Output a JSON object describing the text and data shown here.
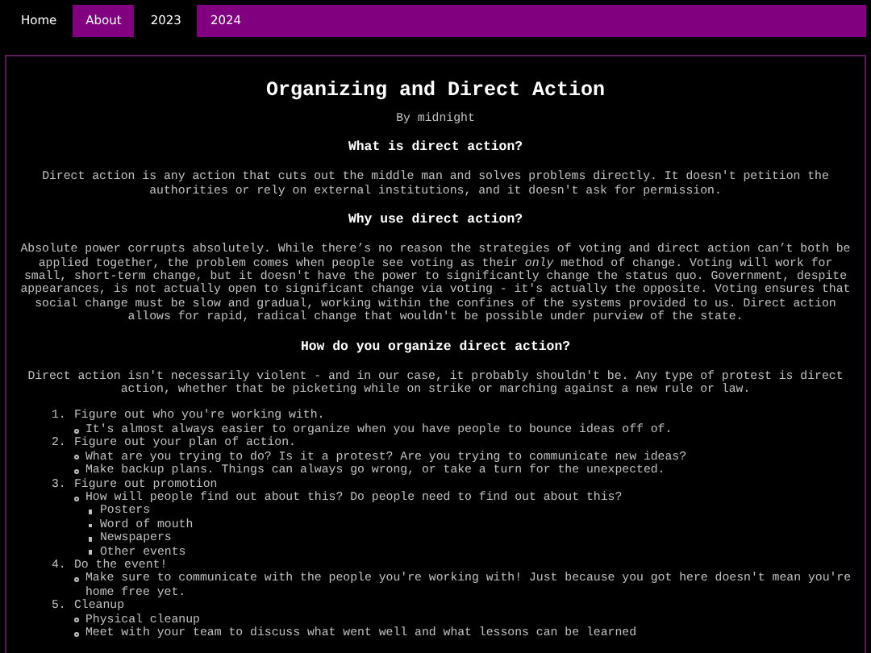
{
  "nav": [
    {
      "label": "Home",
      "highlighted": false
    },
    {
      "label": "About",
      "highlighted": true
    },
    {
      "label": "2023",
      "highlighted": false
    },
    {
      "label": "2024",
      "highlighted": true
    }
  ],
  "article": {
    "title": "Organizing and Direct Action",
    "byline": "By midnight",
    "sections": [
      {
        "heading": "What is direct action?",
        "paragraph": "Direct action is any action that cuts out the middle man and solves problems directly. It doesn't petition the authorities or rely on external institutions, and it doesn't ask for permission."
      },
      {
        "heading": "Why use direct action?",
        "paragraph": "Absolute power corrupts absolutely. While there’s no reason the strategies of voting and direct action can’t both be applied together, the problem comes when people see voting as their *only* method of change. Voting will work for small, short-term change, but it doesn't have the power to significantly change the status quo. Government, despite appearances, is not actually open to significant change via voting - it's actually the opposite. Voting ensures that social change must be slow and gradual, working within the confines of the systems provided to us. Direct action allows for rapid, radical change that wouldn't be possible under purview of the state."
      },
      {
        "heading": "How do you organize direct action?",
        "paragraph": "Direct action isn't necessarily violent - and in our case, it probably shouldn't be. Any type of protest is direct action, whether that be picketing while on strike or marching against a new rule or law."
      }
    ],
    "steps": [
      {
        "number": "1.",
        "text": "Figure out who you're working with.",
        "children": [
          {
            "text": "It's almost always easier to organize when you have people to bounce ideas off of."
          }
        ]
      },
      {
        "number": "2.",
        "text": "Figure out your plan of action.",
        "children": [
          {
            "text": "What are you trying to do? Is it a protest? Are you trying to communicate new ideas?"
          },
          {
            "text": "Make backup plans. Things can always go wrong, or take a turn for the unexpected."
          }
        ]
      },
      {
        "number": "3.",
        "text": "Figure out promotion",
        "children": [
          {
            "text": "How will people find out about this? Do people need to find out about this?",
            "children": [
              {
                "text": "Posters"
              },
              {
                "text": "Word of mouth"
              },
              {
                "text": "Newspapers"
              },
              {
                "text": "Other events"
              }
            ]
          }
        ]
      },
      {
        "number": "4.",
        "text": "Do the event!",
        "children": [
          {
            "text": "Make sure to communicate with the people you're working with! Just because you got here doesn't mean you're home free yet."
          }
        ]
      },
      {
        "number": "5.",
        "text": "Cleanup",
        "children": [
          {
            "text": "Physical cleanup"
          },
          {
            "text": "Meet with your team to discuss what went well and what lessons can be learned"
          }
        ]
      }
    ]
  }
}
